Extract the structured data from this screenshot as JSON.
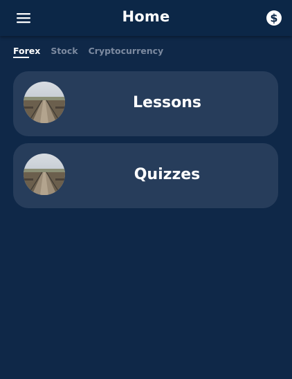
{
  "header": {
    "title": "Home",
    "menu_icon": "hamburger-menu-icon",
    "currency_icon": "dollar-circle-icon"
  },
  "tabs": [
    {
      "label": "Forex",
      "active": true
    },
    {
      "label": "Stock",
      "active": false
    },
    {
      "label": "Cryptocurrency",
      "active": false
    }
  ],
  "cards": [
    {
      "label": "Lessons",
      "thumbnail": "boardwalk-landscape"
    },
    {
      "label": "Quizzes",
      "thumbnail": "boardwalk-landscape"
    }
  ],
  "colors": {
    "background": "#0f2848",
    "header": "#0c2747",
    "card": "#273d5b",
    "text": "#ffffff",
    "inactive_tab": "#7c8aa0"
  }
}
